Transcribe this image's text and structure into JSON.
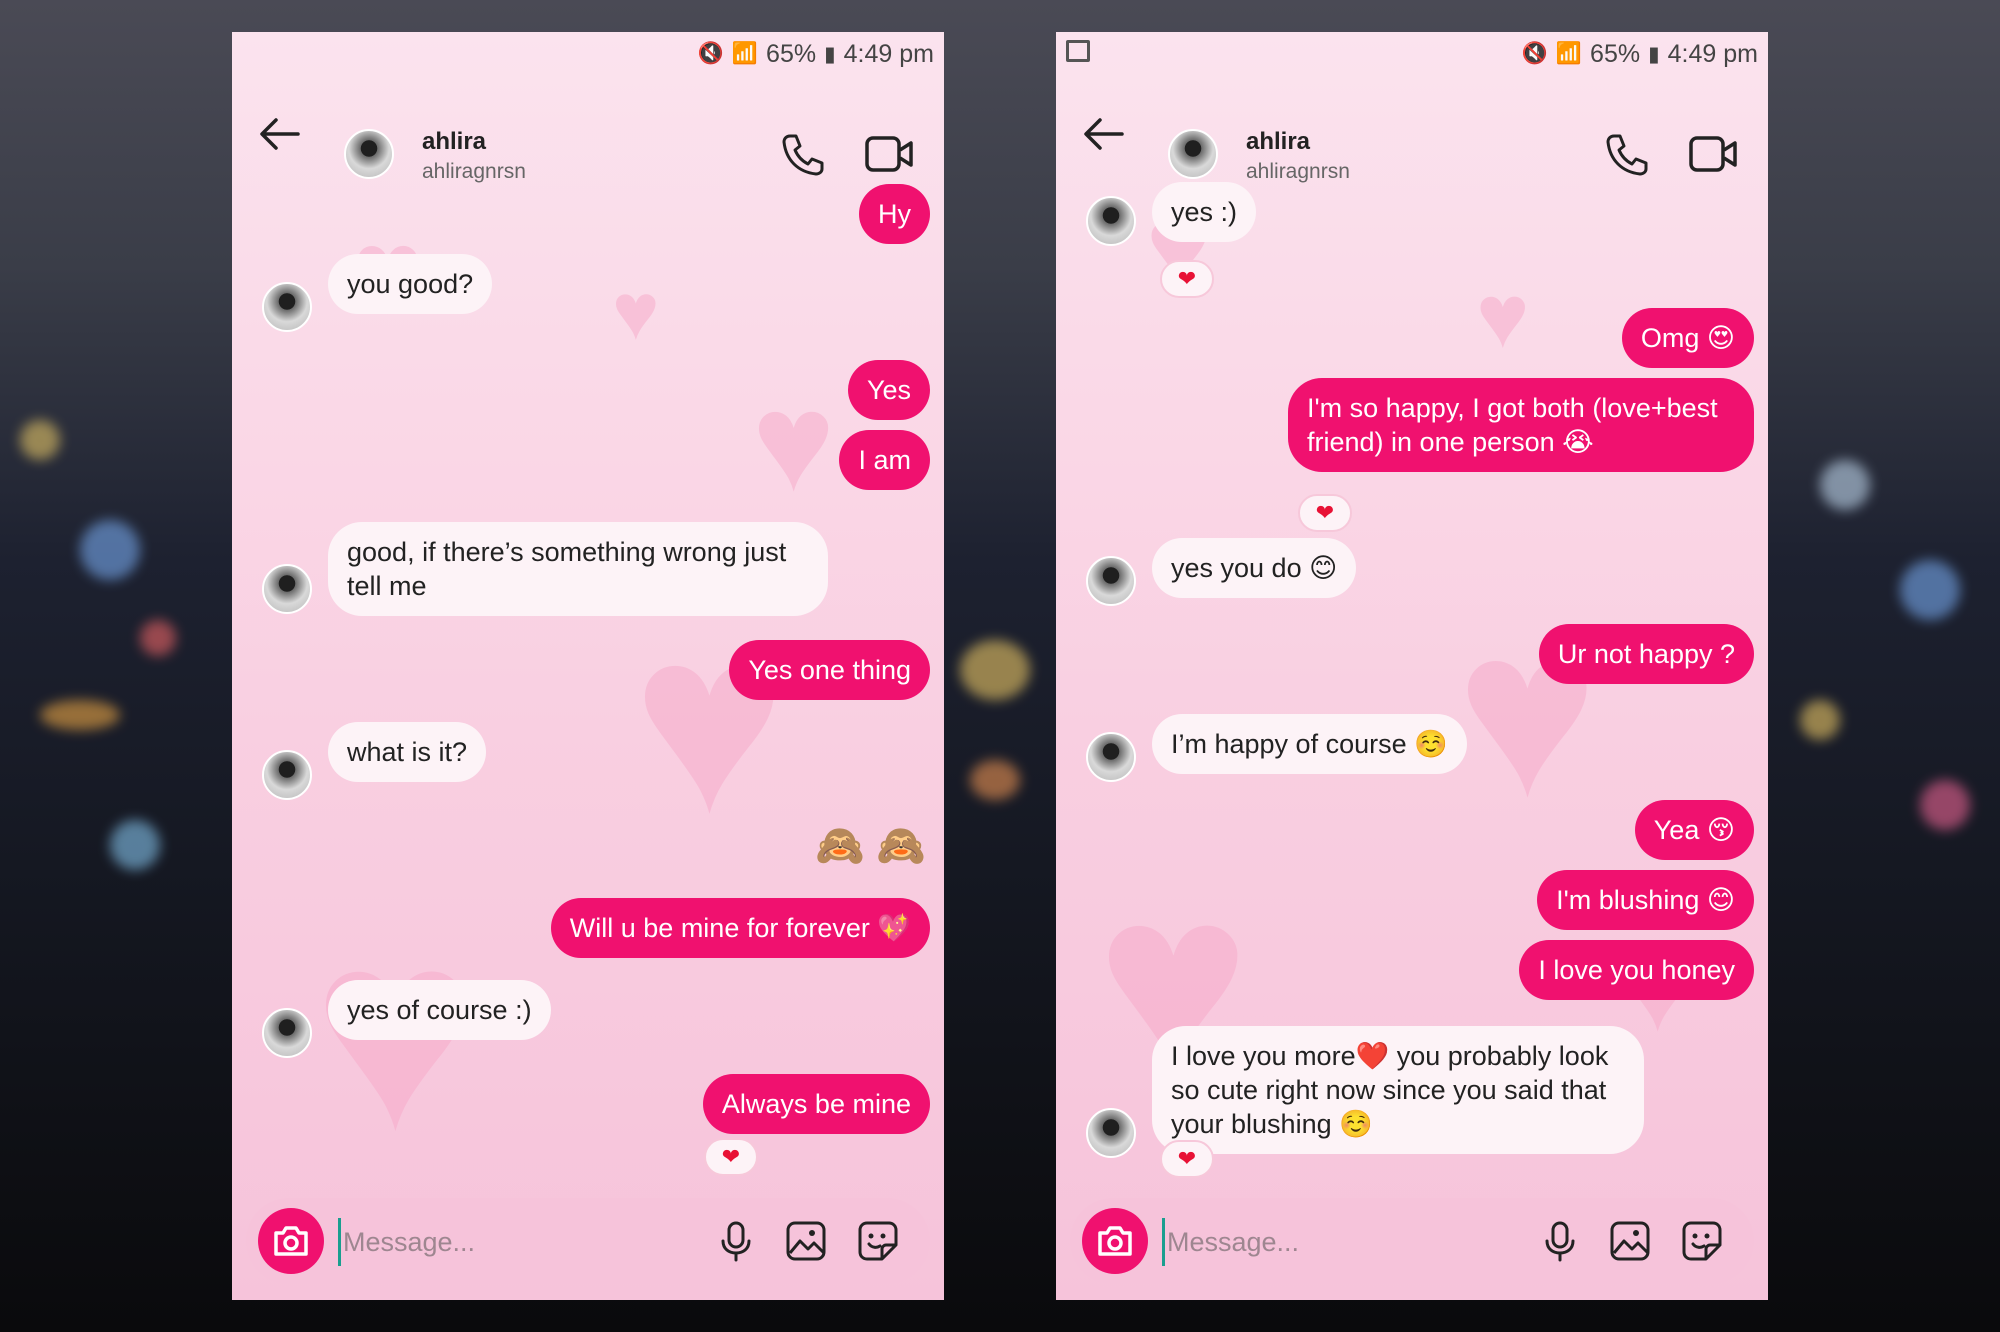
{
  "status_bar": {
    "battery": "65%",
    "time": "4:49 pm"
  },
  "contact": {
    "name": "ahlira",
    "username": "ahliragnrsn"
  },
  "composer": {
    "placeholder": "Message..."
  },
  "left_chat": {
    "messages": [
      {
        "side": "out",
        "text": "Hy"
      },
      {
        "side": "in",
        "text": "you good?"
      },
      {
        "side": "out",
        "text": "Yes"
      },
      {
        "side": "out",
        "text": "I am"
      },
      {
        "side": "in",
        "text": "good, if there’s something wrong just tell me"
      },
      {
        "side": "out",
        "text": "Yes one thing"
      },
      {
        "side": "in",
        "text": "what is it?"
      },
      {
        "side": "out",
        "text": "🙈 🙈"
      },
      {
        "side": "out",
        "text": "Will u be mine for forever 💖"
      },
      {
        "side": "in",
        "text": "yes of course :)"
      },
      {
        "side": "out",
        "text": "Always be mine",
        "reaction": "❤"
      }
    ]
  },
  "right_chat": {
    "messages": [
      {
        "side": "in",
        "text": "yes :)",
        "reaction": "❤"
      },
      {
        "side": "out",
        "text": "Omg 😍"
      },
      {
        "side": "out",
        "text": "I'm so happy, I got both (love+best friend) in one person 😭",
        "reaction": "❤"
      },
      {
        "side": "in",
        "text": "yes you do 😊"
      },
      {
        "side": "out",
        "text": "Ur not happy ?"
      },
      {
        "side": "in",
        "text": "I’m happy of course ☺️"
      },
      {
        "side": "out",
        "text": "Yea 😚"
      },
      {
        "side": "out",
        "text": "I'm blushing 😊"
      },
      {
        "side": "out",
        "text": "I love you honey"
      },
      {
        "side": "in",
        "text": "I love you more❤️ you probably look so cute right now since you said that your blushing ☺️",
        "reaction": "❤"
      }
    ]
  }
}
